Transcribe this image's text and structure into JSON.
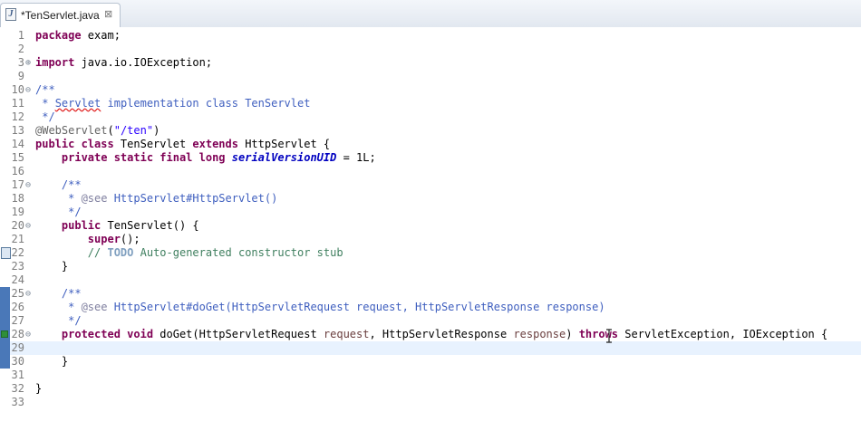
{
  "tab": {
    "title": "*TenServlet.java",
    "close_glyph": "⊠",
    "file_icon": "J"
  },
  "lines": [
    {
      "n": "1",
      "parts": [
        {
          "t": "package",
          "c": "kw"
        },
        {
          "t": " exam;",
          "c": ""
        }
      ]
    },
    {
      "n": "2",
      "parts": []
    },
    {
      "n": "3",
      "fold": "⊕",
      "parts": [
        {
          "t": "import",
          "c": "kw"
        },
        {
          "t": " java.io.IOException;",
          "c": ""
        }
      ]
    },
    {
      "n": "9",
      "parts": []
    },
    {
      "n": "10",
      "fold": "⊖",
      "parts": [
        {
          "t": "/**",
          "c": "jd"
        }
      ]
    },
    {
      "n": "11",
      "parts": [
        {
          "t": " * ",
          "c": "jd"
        },
        {
          "t": "Servlet",
          "c": "jd sq"
        },
        {
          "t": " implementation class TenServlet",
          "c": "jd"
        }
      ]
    },
    {
      "n": "12",
      "parts": [
        {
          "t": " */",
          "c": "jd"
        }
      ]
    },
    {
      "n": "13",
      "parts": [
        {
          "t": "@WebServlet",
          "c": "an"
        },
        {
          "t": "(",
          "c": ""
        },
        {
          "t": "\"/ten\"",
          "c": "st"
        },
        {
          "t": ")",
          "c": ""
        }
      ]
    },
    {
      "n": "14",
      "parts": [
        {
          "t": "public class",
          "c": "kw"
        },
        {
          "t": " TenServlet ",
          "c": ""
        },
        {
          "t": "extends",
          "c": "kw"
        },
        {
          "t": " HttpServlet {",
          "c": ""
        }
      ]
    },
    {
      "n": "15",
      "parts": [
        {
          "t": "    ",
          "c": ""
        },
        {
          "t": "private static final long",
          "c": "kw"
        },
        {
          "t": " ",
          "c": ""
        },
        {
          "t": "serialVersionUID",
          "c": "fld"
        },
        {
          "t": " = 1L;",
          "c": ""
        }
      ]
    },
    {
      "n": "16",
      "parts": []
    },
    {
      "n": "17",
      "fold": "⊖",
      "parts": [
        {
          "t": "    /**",
          "c": "jd"
        }
      ]
    },
    {
      "n": "18",
      "parts": [
        {
          "t": "     * ",
          "c": "jd"
        },
        {
          "t": "@see",
          "c": "jdlink"
        },
        {
          "t": " HttpServlet#HttpServlet()",
          "c": "jd"
        }
      ]
    },
    {
      "n": "19",
      "parts": [
        {
          "t": "     */",
          "c": "jd"
        }
      ]
    },
    {
      "n": "20",
      "fold": "⊖",
      "parts": [
        {
          "t": "    ",
          "c": ""
        },
        {
          "t": "public",
          "c": "kw"
        },
        {
          "t": " TenServlet() {",
          "c": ""
        }
      ]
    },
    {
      "n": "21",
      "parts": [
        {
          "t": "        ",
          "c": ""
        },
        {
          "t": "super",
          "c": "kw"
        },
        {
          "t": "();",
          "c": ""
        }
      ]
    },
    {
      "n": "22",
      "ann": "todo-marker",
      "parts": [
        {
          "t": "        // ",
          "c": "cm"
        },
        {
          "t": "TODO",
          "c": "todo"
        },
        {
          "t": " Auto-generated constructor stub",
          "c": "cm"
        }
      ]
    },
    {
      "n": "23",
      "parts": [
        {
          "t": "    }",
          "c": ""
        }
      ]
    },
    {
      "n": "24",
      "parts": []
    },
    {
      "n": "25",
      "fold": "⊖",
      "parts": [
        {
          "t": "    /**",
          "c": "jd"
        }
      ]
    },
    {
      "n": "26",
      "parts": [
        {
          "t": "     * ",
          "c": "jd"
        },
        {
          "t": "@see",
          "c": "jdlink"
        },
        {
          "t": " HttpServlet#doGet(HttpServletRequest request, HttpServletResponse response)",
          "c": "jd"
        }
      ]
    },
    {
      "n": "27",
      "parts": [
        {
          "t": "     */",
          "c": "jd"
        }
      ]
    },
    {
      "n": "28",
      "fold": "⊖",
      "ann": "override-marker",
      "parts": [
        {
          "t": "    ",
          "c": ""
        },
        {
          "t": "protected void",
          "c": "kw"
        },
        {
          "t": " doGet(HttpServletRequest ",
          "c": ""
        },
        {
          "t": "request",
          "c": "prm"
        },
        {
          "t": ", HttpServletResponse ",
          "c": ""
        },
        {
          "t": "response",
          "c": "prm"
        },
        {
          "t": ") ",
          "c": ""
        },
        {
          "t": "throws",
          "c": "kw"
        },
        {
          "t": " ServletException, IOException {",
          "c": ""
        }
      ]
    },
    {
      "n": "29",
      "current": true,
      "parts": []
    },
    {
      "n": "30",
      "parts": [
        {
          "t": "    }",
          "c": ""
        }
      ]
    },
    {
      "n": "31",
      "parts": []
    },
    {
      "n": "32",
      "parts": [
        {
          "t": "}",
          "c": ""
        }
      ]
    },
    {
      "n": "33",
      "parts": []
    }
  ],
  "colors": {
    "keyword": "#7f0055",
    "comment": "#3f7f5f",
    "javadoc": "#3f5fbf",
    "annotation": "#646464",
    "string": "#2a00ff",
    "field": "#0000c0",
    "parameter": "#6a3e3e",
    "current_line": "#e8f2fe",
    "change_marker": "#4a78b8"
  },
  "cursor_icon": "text-ibeam-cursor-icon"
}
